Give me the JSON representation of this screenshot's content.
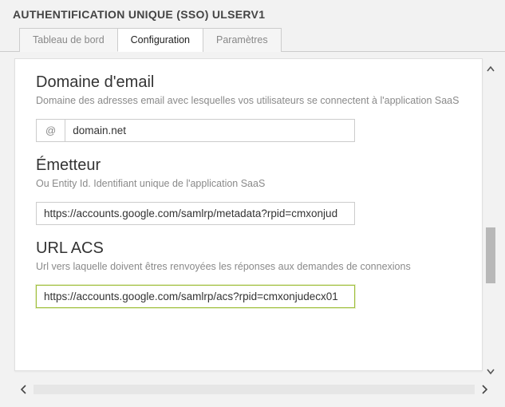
{
  "header": {
    "title_prefix": "AUTHENTIFICATION UNIQUE (SSO)",
    "title_server": "ULSERV1"
  },
  "tabs": [
    {
      "label": "Tableau de bord",
      "active": false
    },
    {
      "label": "Configuration",
      "active": true
    },
    {
      "label": "Paramètres",
      "active": false
    }
  ],
  "sections": {
    "email_domain": {
      "heading": "Domaine d'email",
      "description": "Domaine des adresses email avec lesquelles vos utilisateurs se connectent à l'application SaaS",
      "addon": "@",
      "value": "domain.net"
    },
    "issuer": {
      "heading": "Émetteur",
      "description": "Ou Entity Id. Identifiant unique de l'application SaaS",
      "value": "https://accounts.google.com/samlrp/metadata?rpid=cmxonjud"
    },
    "acs_url": {
      "heading": "URL ACS",
      "description": "Url vers laquelle doivent êtres renvoyées les réponses aux demandes de connexions",
      "value": "https://accounts.google.com/samlrp/acs?rpid=cmxonjudecx01"
    }
  }
}
